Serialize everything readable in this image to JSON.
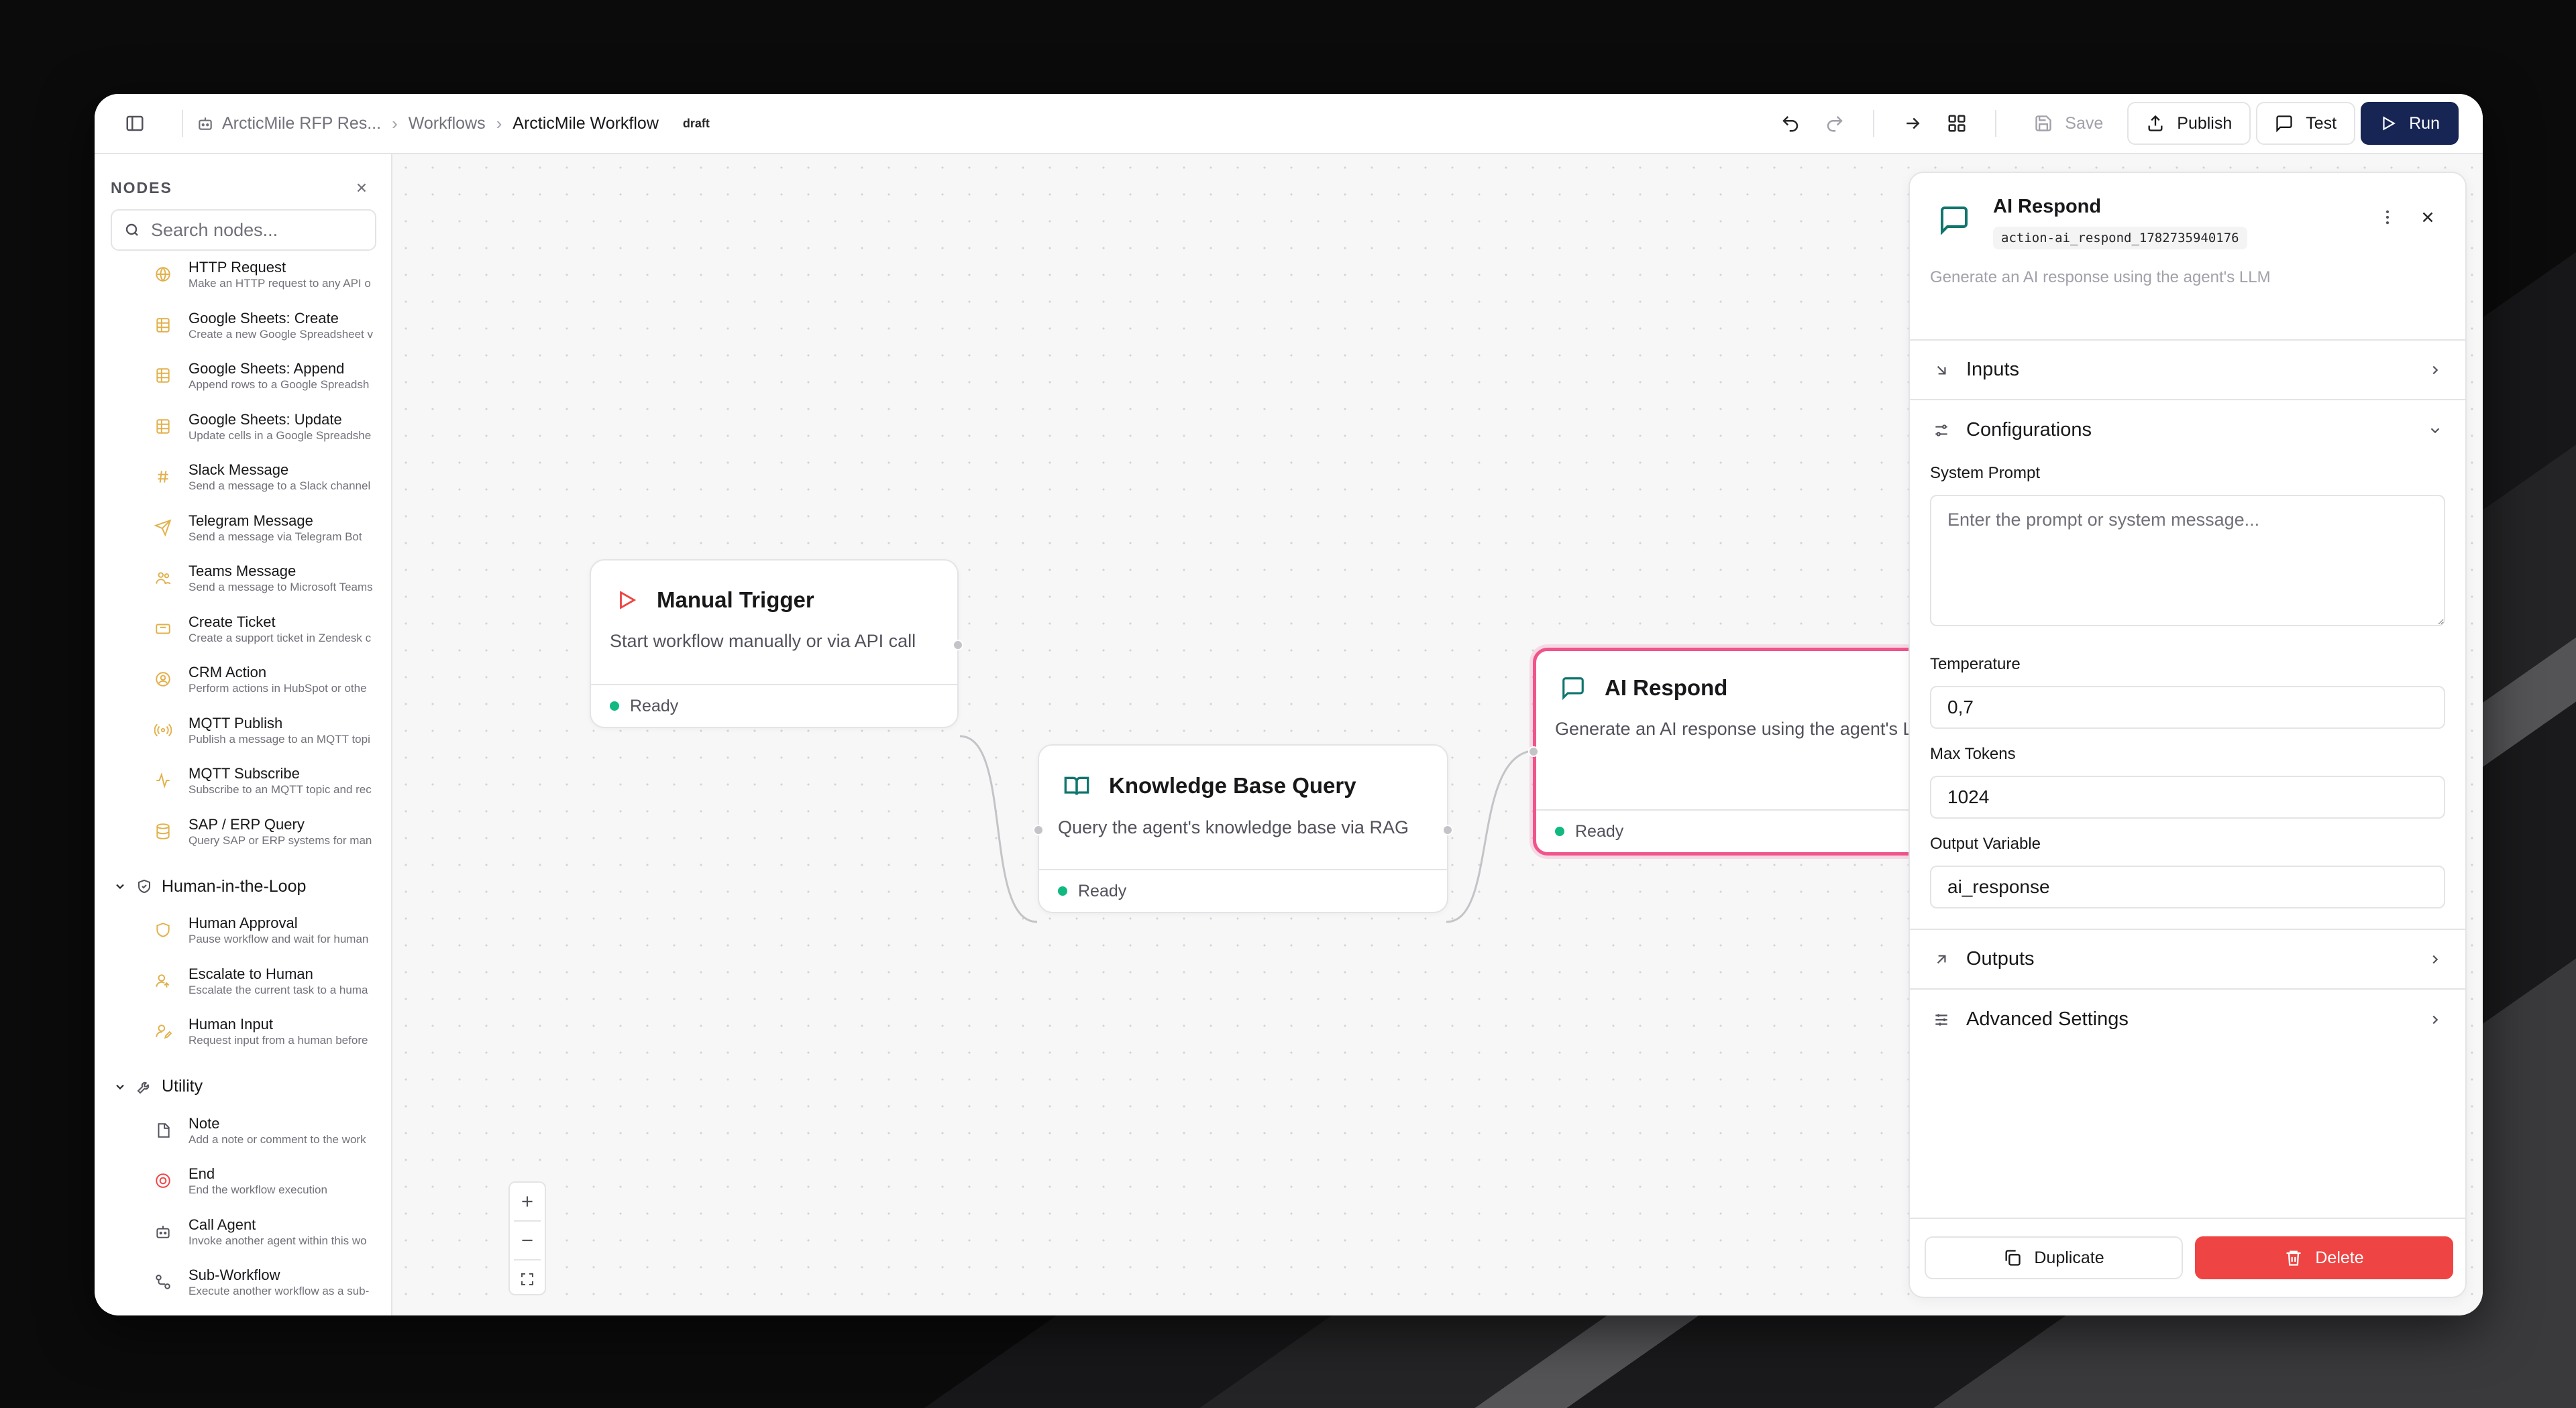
{
  "topbar": {
    "breadcrumb": [
      "ArcticMile RFP Res...",
      "Workflows",
      "ArcticMile Workflow"
    ],
    "status_badge": "draft",
    "save_label": "Save",
    "publish_label": "Publish",
    "test_label": "Test",
    "run_label": "Run"
  },
  "sidebar": {
    "title": "NODES",
    "search_placeholder": "Search nodes...",
    "items_integrations": [
      {
        "title": "HTTP Request",
        "desc": "Make an HTTP request to any API o",
        "icon": "globe-icon"
      },
      {
        "title": "Google Sheets: Create",
        "desc": "Create a new Google Spreadsheet v",
        "icon": "sheet-icon"
      },
      {
        "title": "Google Sheets: Append",
        "desc": "Append rows to a Google Spreadsh",
        "icon": "sheet-icon"
      },
      {
        "title": "Google Sheets: Update",
        "desc": "Update cells in a Google Spreadshe",
        "icon": "sheet-icon"
      },
      {
        "title": "Slack Message",
        "desc": "Send a message to a Slack channel",
        "icon": "hash-icon"
      },
      {
        "title": "Telegram Message",
        "desc": "Send a message via Telegram Bot",
        "icon": "send-icon"
      },
      {
        "title": "Teams Message",
        "desc": "Send a message to Microsoft Teams",
        "icon": "users-icon"
      },
      {
        "title": "Create Ticket",
        "desc": "Create a support ticket in Zendesk c",
        "icon": "ticket-icon"
      },
      {
        "title": "CRM Action",
        "desc": "Perform actions in HubSpot or othe",
        "icon": "user-circle-icon"
      },
      {
        "title": "MQTT Publish",
        "desc": "Publish a message to an MQTT topi",
        "icon": "radio-icon"
      },
      {
        "title": "MQTT Subscribe",
        "desc": "Subscribe to an MQTT topic and rec",
        "icon": "activity-icon"
      },
      {
        "title": "SAP / ERP Query",
        "desc": "Query SAP or ERP systems for man",
        "icon": "database-icon"
      }
    ],
    "group_hitl": "Human-in-the-Loop",
    "items_hitl": [
      {
        "title": "Human Approval",
        "desc": "Pause workflow and wait for human",
        "icon": "shield-icon"
      },
      {
        "title": "Escalate to Human",
        "desc": "Escalate the current task to a huma",
        "icon": "user-escalate-icon"
      },
      {
        "title": "Human Input",
        "desc": "Request input from a human before",
        "icon": "user-edit-icon"
      }
    ],
    "group_utility": "Utility",
    "items_utility": [
      {
        "title": "Note",
        "desc": "Add a note or comment to the work",
        "icon": "file-icon"
      },
      {
        "title": "End",
        "desc": "End the workflow execution",
        "icon": "stop-circle-icon"
      },
      {
        "title": "Call Agent",
        "desc": "Invoke another agent within this wo",
        "icon": "bot-icon"
      },
      {
        "title": "Sub-Workflow",
        "desc": "Execute another workflow as a sub-",
        "icon": "workflow-icon"
      }
    ]
  },
  "canvas": {
    "nodes": [
      {
        "title": "Manual Trigger",
        "desc": "Start workflow manually or via API call",
        "status": "Ready"
      },
      {
        "title": "Knowledge Base Query",
        "desc": "Query the agent's knowledge base via RAG",
        "status": "Ready"
      },
      {
        "title": "AI Respond",
        "desc": "Generate an AI response using the agent's LLM",
        "status": "Ready"
      }
    ]
  },
  "panel": {
    "title": "AI Respond",
    "node_id": "action-ai_respond_1782735940176",
    "description": "Generate an AI response using the agent's LLM",
    "sections": {
      "inputs": "Inputs",
      "configurations": "Configurations",
      "outputs": "Outputs",
      "advanced": "Advanced Settings"
    },
    "fields": {
      "system_prompt_label": "System Prompt",
      "system_prompt_placeholder": "Enter the prompt or system message...",
      "temperature_label": "Temperature",
      "temperature_value": "0,7",
      "max_tokens_label": "Max Tokens",
      "max_tokens_value": "1024",
      "output_variable_label": "Output Variable",
      "output_variable_value": "ai_response"
    },
    "duplicate_label": "Duplicate",
    "delete_label": "Delete"
  },
  "colors": {
    "accent_navy": "#172554",
    "selected_node_border": "#f0548a",
    "danger": "#ef4444",
    "ready_dot": "#10b981",
    "sidebar_icon": "#e2b04a"
  }
}
